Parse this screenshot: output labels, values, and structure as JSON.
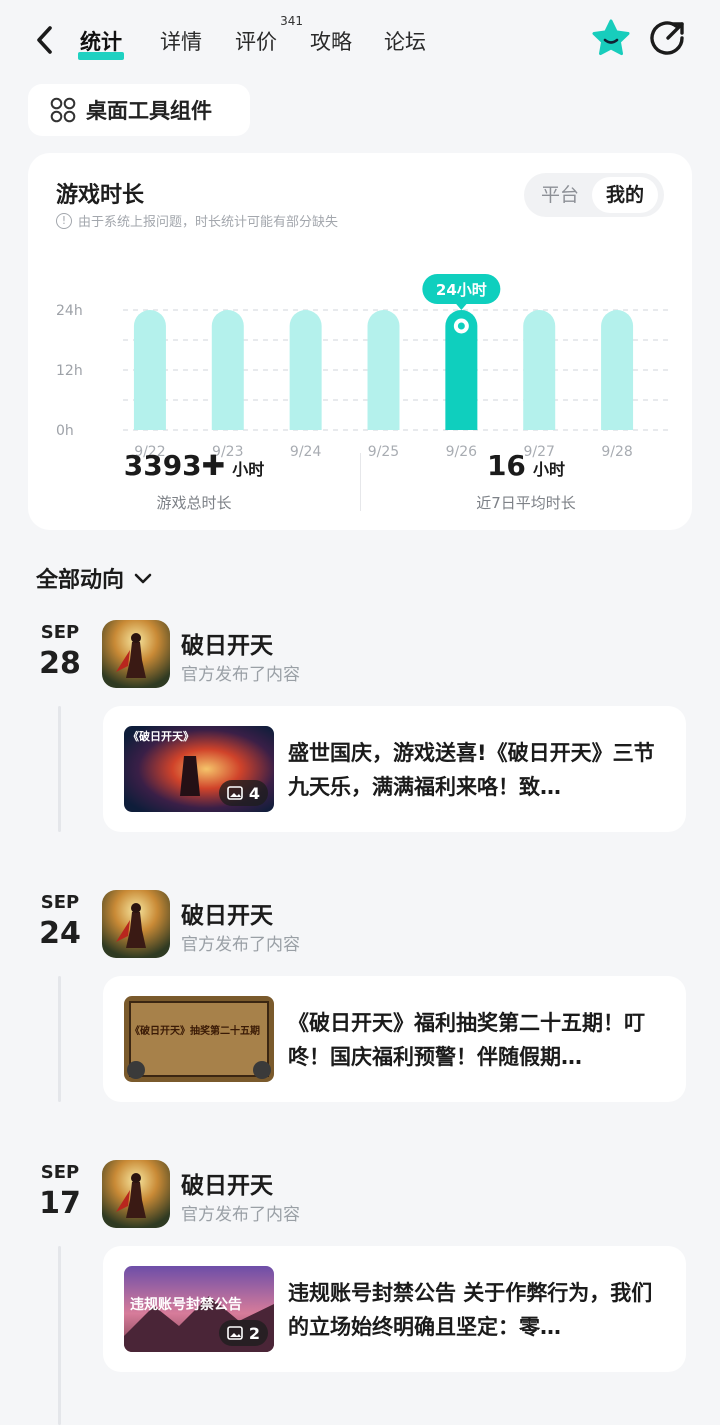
{
  "top_bar": {
    "tabs": [
      {
        "label": "统计",
        "active": true
      },
      {
        "label": "详情"
      },
      {
        "label": "评价",
        "badge": "341"
      },
      {
        "label": "攻略"
      },
      {
        "label": "论坛"
      }
    ]
  },
  "widget_chip": {
    "label": "桌面工具组件"
  },
  "stats": {
    "title": "游戏时长",
    "note": "由于系统上报问题，时长统计可能有部分缺失",
    "segment": {
      "options": [
        "平台",
        "我的"
      ],
      "selected": "我的"
    },
    "total": {
      "value": "3393",
      "plus": "✚",
      "unit": "小时",
      "label": "游戏总时长"
    },
    "average": {
      "value": "16",
      "unit": "小时",
      "label": "近7日平均时长"
    }
  },
  "chart_data": {
    "type": "bar",
    "categories": [
      "9/22",
      "9/23",
      "9/24",
      "9/25",
      "9/26",
      "9/27",
      "9/28"
    ],
    "values": [
      24,
      24,
      24,
      24,
      24,
      24,
      24
    ],
    "highlight_index": 4,
    "highlight_label": "24小时",
    "y_ticks": [
      "24h",
      "12h",
      "0h"
    ],
    "ylim": [
      0,
      24
    ],
    "grid": true,
    "colors": {
      "bar": "#b4f1ec",
      "highlight": "#0fcfbe"
    }
  },
  "feed": {
    "filter_label": "全部动向",
    "items": [
      {
        "month": "SEP",
        "day": "28",
        "game": "破日开天",
        "meta": "官方发布了内容",
        "thumb_text": "《破日开天》",
        "image_count": "4",
        "text": "盛世国庆，游戏送喜!《破日开天》三节九天乐，满满福利来咯！致…"
      },
      {
        "month": "SEP",
        "day": "24",
        "game": "破日开天",
        "meta": "官方发布了内容",
        "thumb_text": "《破日开天》抽奖第二十五期",
        "image_count": "",
        "text": "《破日开天》福利抽奖第二十五期！叮咚！国庆福利预警！伴随假期…"
      },
      {
        "month": "SEP",
        "day": "17",
        "game": "破日开天",
        "meta": "官方发布了内容",
        "thumb_text": "违规账号封禁公告",
        "image_count": "2",
        "text": "违规账号封禁公告 关于作弊行为，我们的立场始终明确且坚定：零…"
      }
    ]
  },
  "colors": {
    "accent": "#1fd1c1",
    "bg": "#f5f6f8"
  }
}
